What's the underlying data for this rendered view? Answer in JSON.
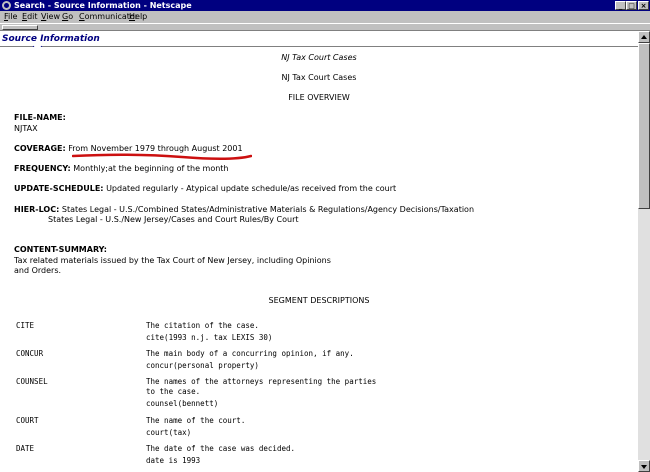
{
  "window": {
    "title": "Search - Source Information - Netscape",
    "minimize": "_",
    "maximize": "□",
    "close": "×"
  },
  "menu": [
    "File",
    "Edit",
    "View",
    "Go",
    "Communicator",
    "Help"
  ],
  "frame": {
    "header": "Source Information"
  },
  "doc": {
    "title_italic": "NJ Tax Court Cases",
    "title_plain": "NJ Tax Court Cases",
    "overview_heading": "FILE OVERVIEW",
    "file_name_label": "FILE-NAME:",
    "file_name_value": "NJTAX",
    "coverage_label": "COVERAGE:",
    "coverage_value": "From November 1979 through August 2001",
    "frequency_label": "FREQUENCY:",
    "frequency_value": "Monthly;at the beginning of the month",
    "update_label": "UPDATE-SCHEDULE:",
    "update_value": "Updated regularly - Atypical update schedule/as received from the court",
    "hierloc_label": "HIER-LOC:",
    "hierloc_value1": "States Legal - U.S./Combined States/Administrative Materials & Regulations/Agency Decisions/Taxation",
    "hierloc_value2": "States Legal - U.S./New Jersey/Cases and Court Rules/By Court",
    "content_summary_label": "CONTENT-SUMMARY:",
    "content_summary_line1": "Tax related materials issued by the Tax Court of New Jersey, including Opinions",
    "content_summary_line2": "and Orders.",
    "segments_heading": "SEGMENT DESCRIPTIONS",
    "segments": [
      {
        "name": "CITE",
        "lines": [
          "The citation of the case.",
          "cite(1993 n.j. tax LEXIS 30)"
        ]
      },
      {
        "name": "CONCUR",
        "lines": [
          "The main body of a concurring opinion, if any.",
          "concur(personal property)"
        ]
      },
      {
        "name": "COUNSEL",
        "lines": [
          "The names of the attorneys representing the parties",
          "to the case.",
          "counsel(bennett)"
        ]
      },
      {
        "name": "COURT",
        "lines": [
          "The name of the court.",
          "court(tax)"
        ]
      },
      {
        "name": "DATE",
        "lines": [
          "The date of the case was decided.",
          "date is 1993"
        ]
      }
    ]
  },
  "colors": {
    "titlebar": "#000080",
    "annotation_underline": "#cc1010",
    "header_text": "#000080"
  }
}
